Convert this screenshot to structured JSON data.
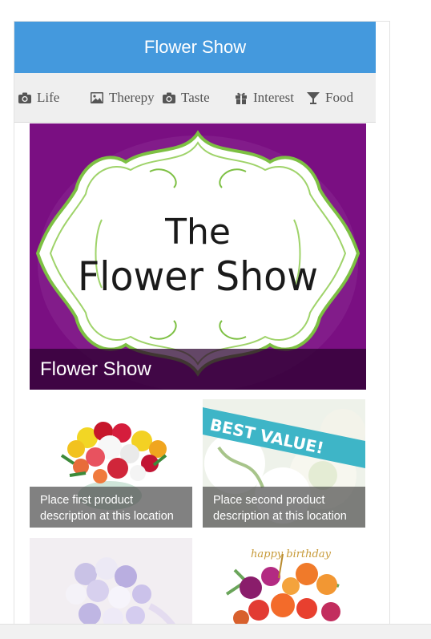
{
  "header": {
    "title": "Flower Show"
  },
  "nav": {
    "items": [
      {
        "label": "Life",
        "icon": "camera-icon"
      },
      {
        "label": "Therepy",
        "icon": "picture-icon"
      },
      {
        "label": "Taste",
        "icon": "camera-icon"
      },
      {
        "label": "Interest",
        "icon": "gift-icon"
      },
      {
        "label": "Food",
        "icon": "cocktail-glass-icon"
      }
    ]
  },
  "hero": {
    "caption": "Flower Show",
    "sign_line1": "The",
    "sign_line2": "Flower Show",
    "colors": {
      "background": "#7a0f82",
      "frame": "#7dc043"
    }
  },
  "products": [
    {
      "caption": "Place first product description at this location"
    },
    {
      "caption": "Place second product description at this location",
      "banner": "BEST VALUE!"
    },
    {
      "caption": ""
    },
    {
      "caption": "",
      "topper": "happy birthday"
    }
  ],
  "colors": {
    "header": "#4499dd",
    "nav_bg": "#efefef",
    "nav_text": "#555555"
  }
}
